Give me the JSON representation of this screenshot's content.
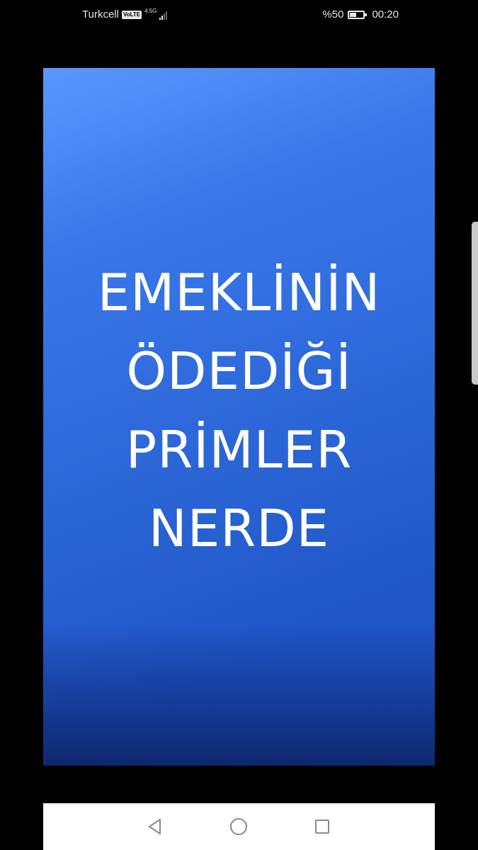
{
  "status_bar": {
    "carrier": "Turkcell",
    "volte": "VoLTE",
    "network": "4.5G",
    "battery_text": "%50",
    "battery_level": 0.5,
    "time": "00:20"
  },
  "headline": {
    "lines": [
      "EMEKLİNİN",
      "ÖDEDİĞİ",
      "PRİMLER",
      "NERDE"
    ]
  },
  "nav": {
    "back_icon": "triangle-back-icon",
    "home_icon": "circle-home-icon",
    "recent_icon": "square-recent-icon"
  },
  "colors": {
    "card_top": "#5a98ff",
    "card_bottom": "#1f55c6",
    "text": "#ffffff"
  }
}
